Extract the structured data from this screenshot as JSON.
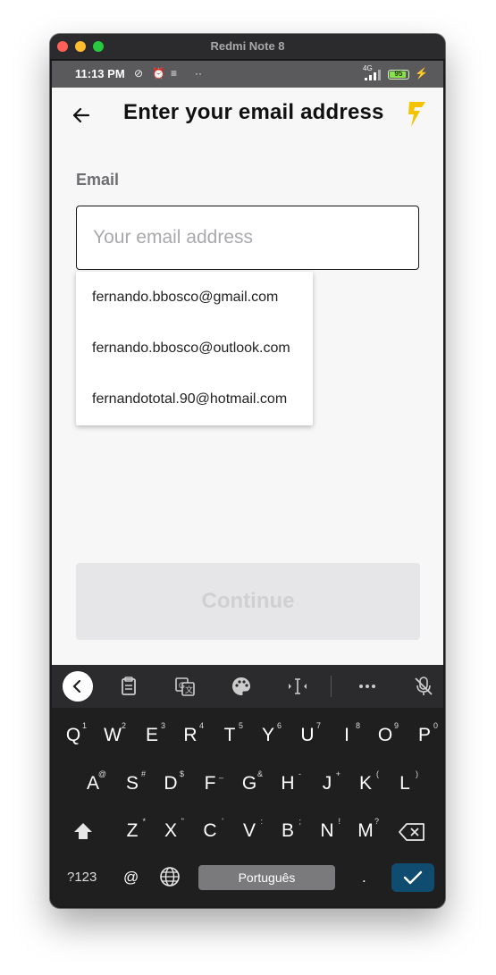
{
  "window": {
    "title": "Redmi Note 8"
  },
  "status_bar": {
    "time": "11:13 PM",
    "network": "4G",
    "battery": "95",
    "battery_level": 0.95
  },
  "header": {
    "title": "Enter your email address"
  },
  "form": {
    "email_label": "Email",
    "email_value": "",
    "email_placeholder": "Your email address",
    "suggestions": [
      "fernando.bbosco@gmail.com",
      "fernando.bbosco@outlook.com",
      "fernandototal.90@hotmail.com"
    ],
    "continue_label": "Continue"
  },
  "keyboard": {
    "row1": [
      {
        "key": "Q",
        "hint": "1"
      },
      {
        "key": "W",
        "hint": "2"
      },
      {
        "key": "E",
        "hint": "3"
      },
      {
        "key": "R",
        "hint": "4"
      },
      {
        "key": "T",
        "hint": "5"
      },
      {
        "key": "Y",
        "hint": "6"
      },
      {
        "key": "U",
        "hint": "7"
      },
      {
        "key": "I",
        "hint": "8"
      },
      {
        "key": "O",
        "hint": "9"
      },
      {
        "key": "P",
        "hint": "0"
      }
    ],
    "row2": [
      {
        "key": "A",
        "hint": "@"
      },
      {
        "key": "S",
        "hint": "#"
      },
      {
        "key": "D",
        "hint": "$"
      },
      {
        "key": "F",
        "hint": "_"
      },
      {
        "key": "G",
        "hint": "&"
      },
      {
        "key": "H",
        "hint": "-"
      },
      {
        "key": "J",
        "hint": "+"
      },
      {
        "key": "K",
        "hint": "("
      },
      {
        "key": "L",
        "hint": ")"
      }
    ],
    "row3": [
      {
        "key": "Z",
        "hint": "*"
      },
      {
        "key": "X",
        "hint": "\""
      },
      {
        "key": "C",
        "hint": "'"
      },
      {
        "key": "V",
        "hint": ":"
      },
      {
        "key": "B",
        "hint": ";"
      },
      {
        "key": "N",
        "hint": "!"
      },
      {
        "key": "M",
        "hint": "?"
      }
    ],
    "symbols_label": "?123",
    "at_label": "@",
    "space_label": "Português",
    "period_label": "."
  },
  "colors": {
    "accent": "#f5c400",
    "enter_key": "#0f4c6f",
    "continue_disabled": "#e6e6e8"
  }
}
